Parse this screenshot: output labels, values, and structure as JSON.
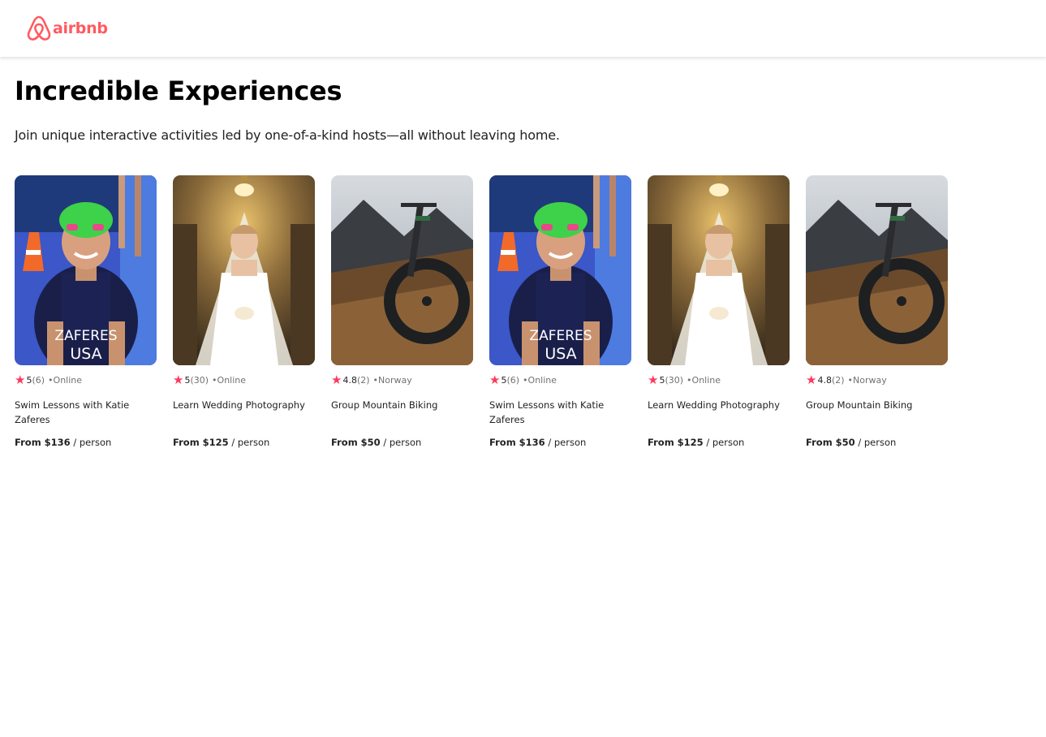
{
  "brand": {
    "name": "airbnb",
    "color": "#FF5A5F"
  },
  "header": {
    "title": "Incredible Experiences",
    "subtitle": "Join unique interactive activities led by one-of-a-kind hosts—all without leaving home."
  },
  "accent": "#FF385C",
  "cards": [
    {
      "image": "swimmer-photo",
      "rating": "5",
      "reviews": "(6)",
      "location": "•Online",
      "title": "Swim Lessons with Katie Zaferes",
      "price_label": "From $136",
      "price_unit": " / person"
    },
    {
      "image": "bride-photo",
      "rating": "5",
      "reviews": "(30)",
      "location": "•Online",
      "title": "Learn Wedding Photography",
      "price_label": "From $125",
      "price_unit": " / person"
    },
    {
      "image": "mountain-bike-photo",
      "rating": "4.8",
      "reviews": "(2)",
      "location": "•Norway",
      "title": "Group Mountain Biking",
      "price_label": "From $50",
      "price_unit": " / person"
    },
    {
      "image": "swimmer-photo",
      "rating": "5",
      "reviews": "(6)",
      "location": "•Online",
      "title": "Swim Lessons with Katie Zaferes",
      "price_label": "From $136",
      "price_unit": " / person"
    },
    {
      "image": "bride-photo",
      "rating": "5",
      "reviews": "(30)",
      "location": "•Online",
      "title": "Learn Wedding Photography",
      "price_label": "From $125",
      "price_unit": " / person"
    },
    {
      "image": "mountain-bike-photo",
      "rating": "4.8",
      "reviews": "(2)",
      "location": "•Norway",
      "title": "Group Mountain Biking",
      "price_label": "From $50",
      "price_unit": " / person"
    }
  ],
  "icons": {
    "star": "★",
    "logo": "airbnb-logo-icon"
  }
}
